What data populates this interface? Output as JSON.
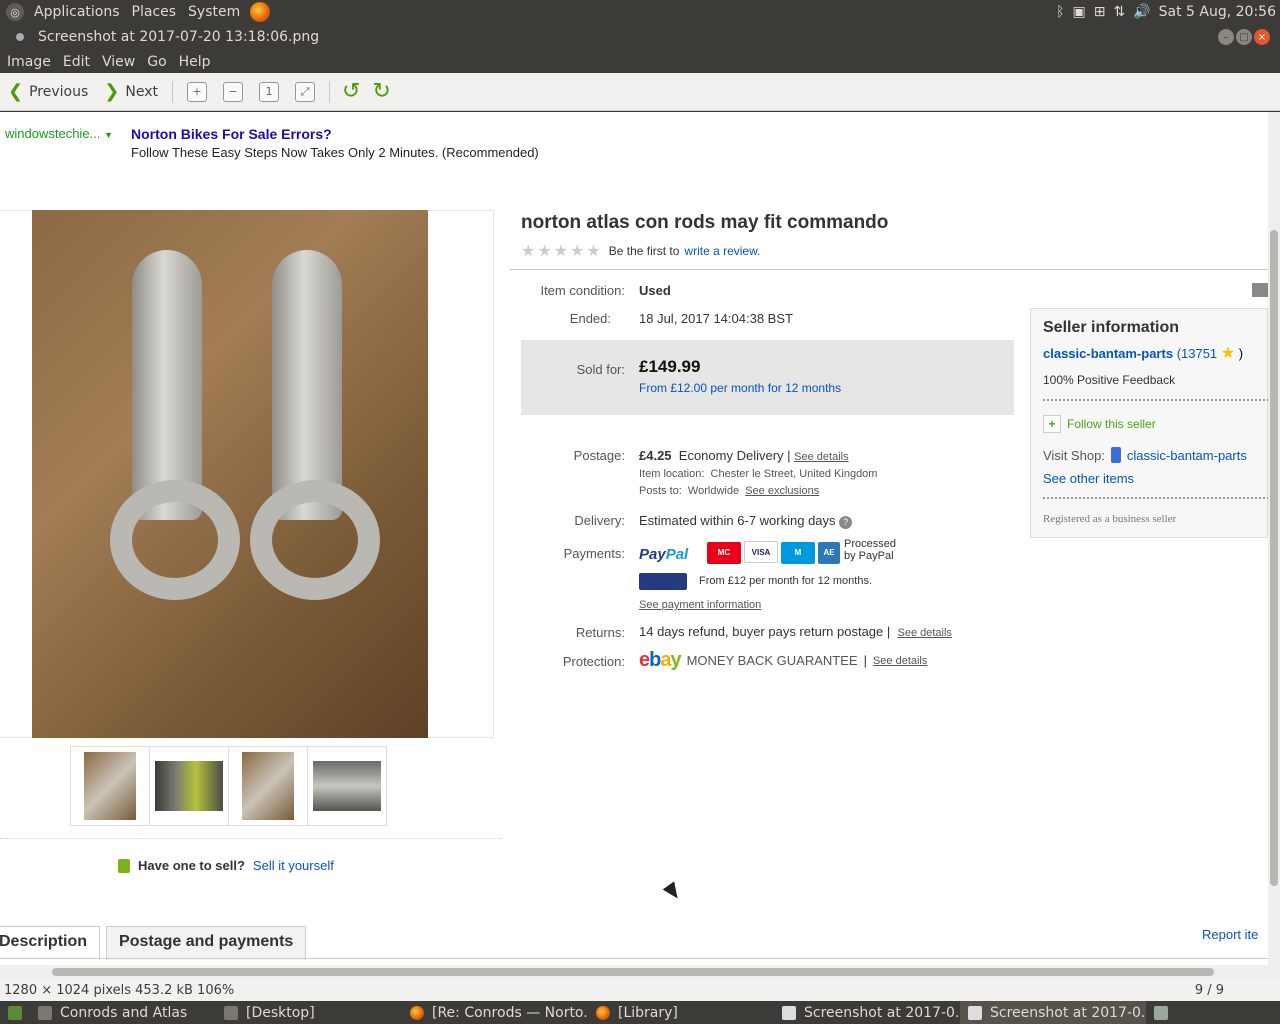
{
  "top_panel": {
    "menus": [
      "Applications",
      "Places",
      "System"
    ],
    "clock": "Sat  5 Aug, 20:56"
  },
  "window": {
    "title": "Screenshot at 2017-07-20 13:18:06.png"
  },
  "menubar": [
    "Image",
    "Edit",
    "View",
    "Go",
    "Help"
  ],
  "toolbar": {
    "previous": "Previous",
    "next": "Next"
  },
  "page": {
    "ad": {
      "source": "windowstechie...",
      "title": "Norton Bikes For Sale Errors?",
      "text": "Follow These Easy Steps Now Takes Only 2 Minutes. (Recommended)"
    },
    "item_title": "norton atlas con rods may fit commando",
    "review_prefix": "Be the first to",
    "review_link": "write a review.",
    "condition_label": "Item condition:",
    "condition_value": "Used",
    "ended_label": "Ended:",
    "ended_value": "18 Jul, 2017  14:04:38 BST",
    "sold_label": "Sold for:",
    "sold_price": "£149.99",
    "finance": "From £12.00 per month for 12 months",
    "postage_label": "Postage:",
    "postage_price": "£4.25",
    "postage_type": "Economy Delivery",
    "see_details": "See details",
    "item_location_label": "Item location:",
    "item_location": "Chester le Street, United Kingdom",
    "posts_to_label": "Posts to:",
    "posts_to": "Worldwide",
    "see_exclusions": "See exclusions",
    "delivery_label": "Delivery:",
    "delivery_value": "Estimated within 6-7 working days",
    "payments_label": "Payments:",
    "paypal_word_1": "Pay",
    "paypal_word_2": "Pal",
    "processed": "Processed by PayPal",
    "credit_text": "From £12 per month for 12 months.",
    "see_payment": "See payment information",
    "returns_label": "Returns:",
    "returns_value": "14 days refund, buyer pays return postage",
    "protection_label": "Protection:",
    "money_back": "MONEY BACK GUARANTEE",
    "seller": {
      "heading": "Seller information",
      "name": "classic-bantam-parts",
      "score": "(13751",
      "score_close": ")",
      "feedback": "100% Positive Feedback",
      "follow": "Follow this seller",
      "visit_shop_label": "Visit Shop:",
      "shop_name": "classic-bantam-parts",
      "see_other": "See other items",
      "registered": "Registered as a business seller"
    },
    "have_one": "Have one to sell?",
    "sell_it": "Sell it yourself",
    "tab_description": "Description",
    "tab_postage": "Postage and payments",
    "report": "Report ite"
  },
  "statusbar": {
    "info": "1280 × 1024 pixels  453.2 kB    106%",
    "position": "9 / 9"
  },
  "taskbar": [
    {
      "label": "Conrods and Atlas",
      "icon": "folder-icon"
    },
    {
      "label": "[Desktop]",
      "icon": "desktop-icon"
    },
    {
      "label": "[Re: Conrods — Norto...",
      "icon": "firefox-icon"
    },
    {
      "label": "[Library]",
      "icon": "firefox-icon"
    },
    {
      "label": "Screenshot at 2017-0...",
      "icon": "image-viewer-icon"
    },
    {
      "label": "Screenshot at 2017-0...",
      "icon": "image-viewer-icon"
    }
  ]
}
